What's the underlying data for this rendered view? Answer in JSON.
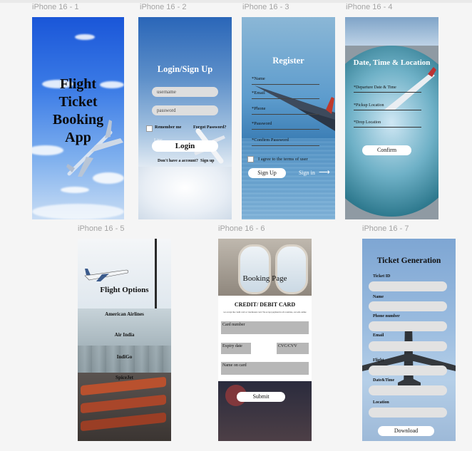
{
  "canvas": {
    "background": "#f5f5f5"
  },
  "frames": {
    "f1": {
      "label": "iPhone 16 - 1",
      "title_lines": [
        "Flight",
        "Ticket",
        "Booking",
        "App"
      ]
    },
    "f2": {
      "label": "iPhone 16 - 2",
      "title": "Login/Sign Up",
      "username_placeholder": "username",
      "password_placeholder": "password",
      "remember_label": "Remember me",
      "forgot_label": "Forgot Password?",
      "login_label": "Login",
      "no_account_label": "Don't have a account?",
      "signup_link": "Sign up"
    },
    "f3": {
      "label": "iPhone 16 - 3",
      "title": "Register",
      "fields": [
        "*Name",
        "*Email",
        "*Phone",
        "*Password",
        "*Confirm Password"
      ],
      "terms_label": "I agree to the terms of user",
      "signup_button": "Sign Up",
      "signin_link": "Sign in",
      "arrow": "⟶"
    },
    "f4": {
      "label": "iPhone 16 - 4",
      "title": "Date, Time & Location",
      "fields": [
        "*Departure Date & Time",
        "*Pickup Location",
        "*Drop Location"
      ],
      "confirm_button": "Confirm"
    },
    "f5": {
      "label": "iPhone 16 - 5",
      "title": "Flight Options",
      "options": [
        "American Airlines",
        "Air India",
        "IndiGo",
        "SpiceJet"
      ]
    },
    "f6": {
      "label": "iPhone 16 - 6",
      "title": "Booking Page",
      "card_heading": "CREDIT/ DEBIT CARD",
      "card_subtext": "we accept the credit card or visa/master card. We accept payment in all countries, our safe online",
      "card_number_label": "Card number",
      "expiry_label": "Expiry date",
      "cvc_label": "CVC/CVV",
      "name_label": "Name on card",
      "submit_button": "Submit"
    },
    "f7": {
      "label": "iPhone 16 - 7",
      "title": "Ticket Generation",
      "fields": [
        "Ticket ID",
        "Name",
        "Phone number",
        "Email",
        "Flight",
        "Date&Time",
        "Location"
      ],
      "download_button": "Download"
    }
  }
}
